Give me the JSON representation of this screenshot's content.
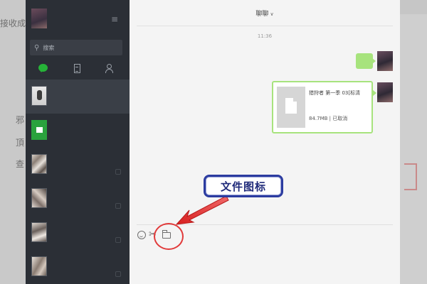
{
  "background_fragments": [
    "接收成",
    "邪",
    "頂",
    "查"
  ],
  "chat": {
    "title": "聊聊",
    "timestamp": "11:36",
    "file": {
      "name": "猎狩者 第一季 03[标清",
      "meta": "84.7MB | 已取消"
    }
  },
  "sidebar": {
    "search_placeholder": "搜索",
    "conversations": [
      "photo",
      "file-transfer",
      "photo",
      "photo",
      "photo",
      "photo"
    ]
  },
  "annotation": {
    "label": "文件图标",
    "color": "#e13a3a",
    "label_border": "#2c3ca0"
  },
  "colors": {
    "sidebar": "#2b2f36",
    "bubble_green": "#a7e37d",
    "accent_green": "#26b338"
  }
}
